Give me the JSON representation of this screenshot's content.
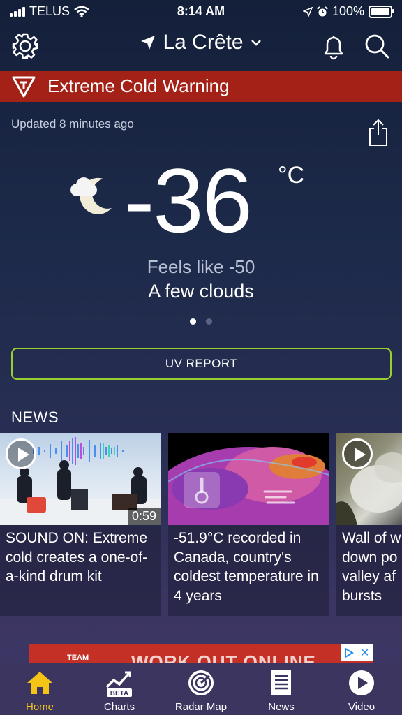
{
  "status_bar": {
    "carrier": "TELUS",
    "time": "8:14 AM",
    "battery": "100%"
  },
  "header": {
    "location": "La Crête"
  },
  "alert": {
    "text": "Extreme Cold Warning",
    "color": "#a32117"
  },
  "weather": {
    "updated": "Updated 8 minutes ago",
    "temperature": "-36",
    "unit": "°C",
    "feels_like": "Feels like -50",
    "description": "A few clouds",
    "icon": "cloudy-night-icon",
    "page_count": 2,
    "page_active": 1
  },
  "uv_button": {
    "label": "UV REPORT",
    "border_color": "#9acd32"
  },
  "news": {
    "title": "NEWS",
    "items": [
      {
        "title": "SOUND ON: Extreme cold creates a one-of-a-kind drum kit",
        "duration": "0:59",
        "has_video": true
      },
      {
        "title": "-51.9°C recorded in Canada, country's coldest temperature in 4 years",
        "has_video": false
      },
      {
        "title": "Wall of w down po valley af bursts",
        "has_video": true
      }
    ]
  },
  "ad": {
    "team": "TEAM",
    "headline": "WORK OUT ONLINE",
    "close": "✕"
  },
  "tabs": [
    {
      "label": "Home",
      "icon": "home-icon",
      "active": true
    },
    {
      "label": "Charts",
      "icon": "charts-icon",
      "badge": "BETA",
      "active": false
    },
    {
      "label": "Radar Map",
      "icon": "radar-icon",
      "active": false
    },
    {
      "label": "News",
      "icon": "news-icon",
      "active": false
    },
    {
      "label": "Video",
      "icon": "video-play-icon",
      "active": false
    }
  ],
  "colors": {
    "active_tab": "#f4c516",
    "tab_bar": "#3b3560"
  }
}
